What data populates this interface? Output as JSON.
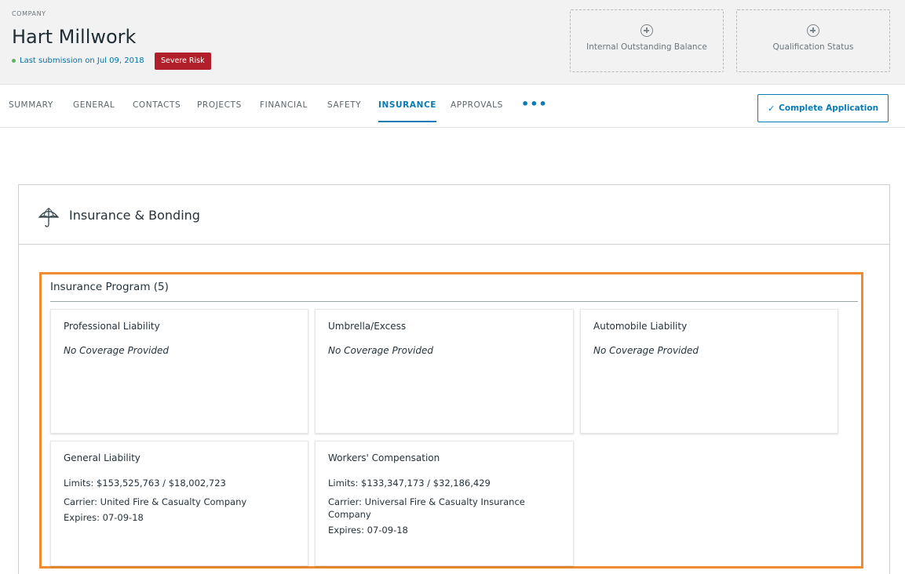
{
  "header": {
    "company_label": "COMPANY",
    "company_name": "Hart Millwork",
    "submission_text": "Last submission on Jul 09, 2018",
    "risk_badge": "Severe Risk",
    "stats": [
      {
        "label": "Internal Outstanding Balance",
        "icon": "plus-circle-icon"
      },
      {
        "label": "Qualification Status",
        "icon": "plus-circle-icon"
      }
    ]
  },
  "tabs": {
    "items": [
      "SUMMARY",
      "GENERAL",
      "CONTACTS",
      "PROJECTS",
      "FINANCIAL",
      "SAFETY",
      "INSURANCE",
      "APPROVALS"
    ],
    "active": "INSURANCE",
    "more": "•••",
    "complete_button": "Complete Application"
  },
  "panel": {
    "title": "Insurance & Bonding",
    "icon": "umbrella-icon",
    "program_title": "Insurance Program (5)",
    "cards": [
      {
        "title": "Professional Liability",
        "empty": "No Coverage Provided"
      },
      {
        "title": "Umbrella/Excess",
        "empty": "No Coverage Provided"
      },
      {
        "title": "Automobile Liability",
        "empty": "No Coverage Provided"
      },
      {
        "title": "General Liability",
        "limits": "Limits: $153,525,763 / $18,002,723",
        "carrier": "Carrier: United Fire & Casualty Company",
        "expires": "Expires: 07-09-18"
      },
      {
        "title": "Workers' Compensation",
        "limits": "Limits: $133,347,173 / $32,186,429",
        "carrier": "Carrier: Universal Fire & Casualty Insurance Company",
        "expires": "Expires: 07-09-18"
      }
    ]
  },
  "colors": {
    "accent": "#0a7ab5",
    "risk": "#b1202a",
    "highlight": "#f08c2e",
    "status_dot": "#5cb85c"
  }
}
